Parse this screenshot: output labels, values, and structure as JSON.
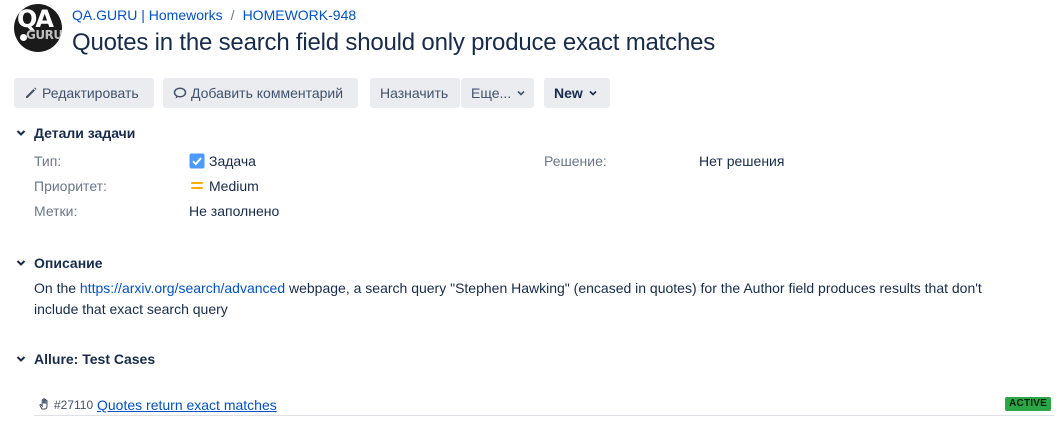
{
  "header": {
    "avatar": {
      "logo_text_top": "QA",
      "logo_text_bottom": "GURU"
    },
    "breadcrumb": {
      "project": "QA.GURU | Homeworks",
      "separator": "/",
      "issue_key": "HOMEWORK-948"
    },
    "title": "Quotes in the search field should only produce exact matches"
  },
  "toolbar": {
    "edit_label": "Редактировать",
    "comment_label": "Добавить комментарий",
    "assign_label": "Назначить",
    "more_label": "Еще...",
    "status_label": "New"
  },
  "details": {
    "heading": "Детали задачи",
    "type_label": "Тип:",
    "type_value": "Задача",
    "priority_label": "Приоритет:",
    "priority_value": "Medium",
    "labels_label": "Метки:",
    "labels_value": "Не заполнено",
    "resolution_label": "Решение:",
    "resolution_value": "Нет решения"
  },
  "description": {
    "heading": "Описание",
    "text_before": "On the ",
    "link": "https://arxiv.org/search/advanced",
    "text_after": " webpage, a search query \"Stephen Hawking\" (encased in quotes) for the Author field produces results that don't include that exact search query"
  },
  "allure": {
    "heading": "Allure: Test Cases",
    "test_cases": [
      {
        "id": "#27110",
        "name": "Quotes return exact matches",
        "status": "ACTIVE"
      }
    ]
  },
  "icons": {
    "edit": "pencil-icon",
    "comment": "speech-bubble-icon",
    "dropdown": "chevron-down-icon",
    "toggle": "chevron-down-icon",
    "type": "checkbox-icon",
    "priority": "priority-medium-icon",
    "manual_test": "hand-icon"
  },
  "colors": {
    "link": "#0052cc",
    "button_bg": "#ebecf0",
    "type_icon": "#4c9aff",
    "priority_icon": "#ffab00",
    "active_badge": "#2aa646"
  }
}
